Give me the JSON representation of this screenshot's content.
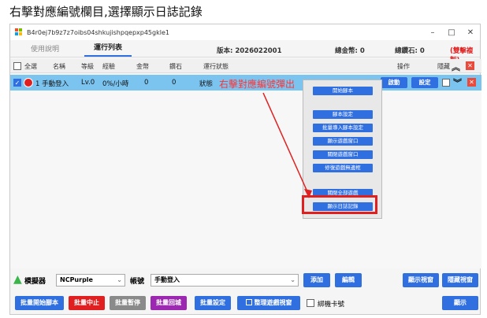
{
  "caption": "右擊對應編號欄目,選擇顯示日誌記錄",
  "window": {
    "title": "B4r0ej7b9z7z7oibs04shkujishpqepxp45gkle1",
    "min": "–",
    "max": "□",
    "close": "✕"
  },
  "tabs": {
    "usage": "使用說明",
    "runlist": "運行列表"
  },
  "info": {
    "version": "版本: 2026022001",
    "gold": "總金幣: 0",
    "diamond": "總鑽石: 0",
    "reward": "(雙擊複製)"
  },
  "columns": {
    "all": "全選",
    "name": "名稱",
    "level": "等級",
    "exp": "經驗",
    "gold": "金幣",
    "diamond": "鑽石",
    "status": "運行狀態",
    "ops": "操作",
    "hide": "隱藏"
  },
  "row": {
    "name": "1 手動登入",
    "level": "Lv.0",
    "exp": "0%/小時",
    "gold": "0",
    "diamond": "0",
    "status": "狀態",
    "start": "啟動",
    "settings": "設定"
  },
  "overlay": "右擊對應編號彈出",
  "menu": [
    "開始腳本",
    "腳本設定",
    "批量導入腳本設定",
    "顯示遊戲窗口",
    "關閉遊戲窗口",
    "修復遊戲無邊框",
    "關閉全部遊戲",
    "顯示日誌記錄"
  ],
  "bottom": {
    "emulator_label": "模擬器",
    "emulator_value": "NCPurple",
    "account_label": "帳號",
    "account_value": "手動登入",
    "add": "添加",
    "edit": "編輯",
    "show_window": "顯示視窗",
    "hide_window": "隱藏視窗",
    "batch_start": "批量開始腳本",
    "batch_stop": "批量中止",
    "batch_pause": "批量暫停",
    "batch_return": "批量回城",
    "batch_settings": "批量設定",
    "arrange": "整理遊戲視窗",
    "bind_card": "綁機卡號",
    "show": "顯示"
  },
  "colors": {
    "accent": "#2f6fe0",
    "selected_row": "#7cc4f0",
    "danger": "#e02020",
    "pink": "#d81b60",
    "gray": "#8a8a8a",
    "purple": "#9c27b0"
  }
}
